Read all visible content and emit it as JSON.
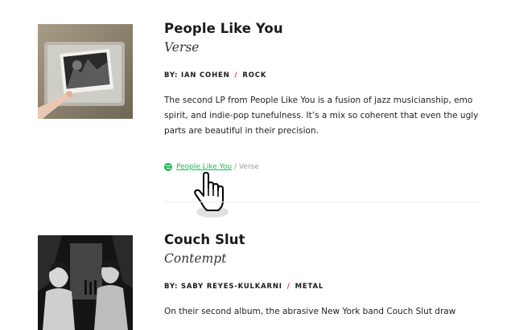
{
  "entries": [
    {
      "title": "People Like You",
      "subtitle": "Verse",
      "author": "BY: IAN COHEN",
      "separator": "/",
      "genre": "ROCK",
      "description": "The second LP from People Like You is a fusion of jazz musicianship, emo spirit, and indie-pop tunefulness. It’s a mix so coherent that even the ugly parts are beautiful in their precision.",
      "listen": {
        "link_text": "People Like You",
        "rest_text": "/ Verse"
      }
    },
    {
      "title": "Couch Slut",
      "subtitle": "Contempt",
      "author": "BY: SABY REYES-KULKARNI",
      "separator": "/",
      "genre": "METAL",
      "description": "On their second album, the abrasive New York band Couch Slut draw"
    }
  ],
  "icons": {
    "listen": "spotify-icon",
    "cursor": "hand-pointer-icon"
  },
  "colors": {
    "accent_red": "#d0352b",
    "spotify_green": "#1db954"
  }
}
